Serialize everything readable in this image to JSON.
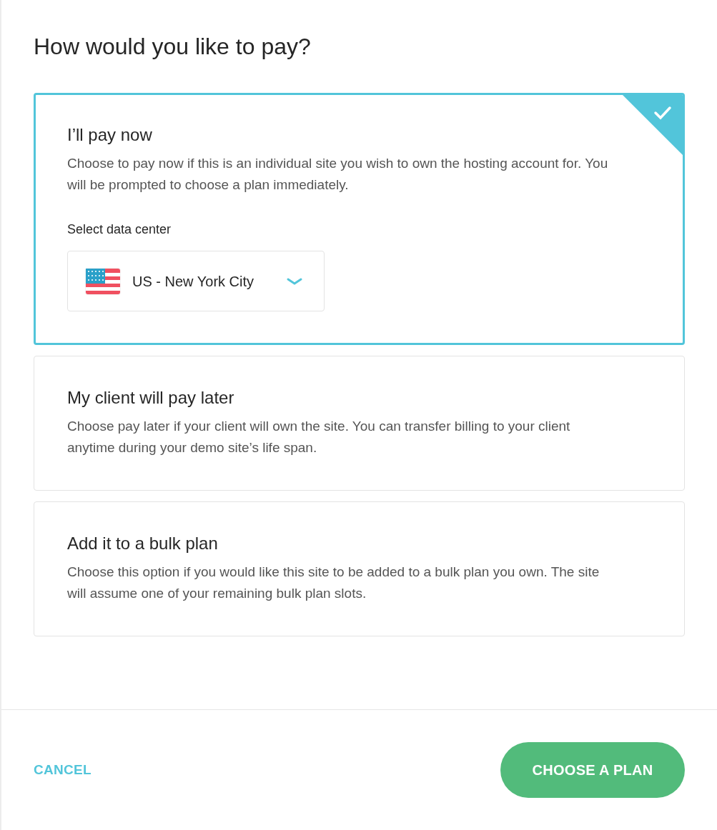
{
  "title": "How would you like to pay?",
  "options": [
    {
      "title": "I’ll pay now",
      "description": "Choose to pay now if this is an individual site you wish to own the hosting account for. You will be prompted to choose a plan immediately.",
      "selected": true,
      "data_center": {
        "label": "Select data center",
        "value": "US - New York City"
      }
    },
    {
      "title": "My client will pay later",
      "description": "Choose pay later if your client will own the site. You can transfer billing to your client anytime during your demo site’s life span.",
      "selected": false
    },
    {
      "title": "Add it to a bulk plan",
      "description": "Choose this option if you would like this site to be added to a bulk plan you own. The site will assume one of your remaining bulk plan slots.",
      "selected": false
    }
  ],
  "footer": {
    "cancel": "CANCEL",
    "confirm": "CHOOSE A PLAN"
  }
}
